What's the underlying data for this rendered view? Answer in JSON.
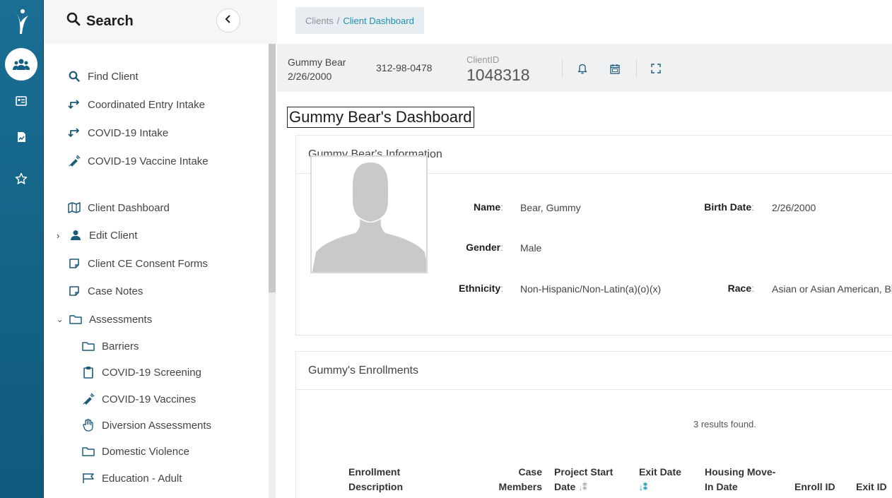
{
  "sidebar": {
    "title": "Search",
    "items": [
      {
        "label": "Find Client"
      },
      {
        "label": "Coordinated Entry Intake"
      },
      {
        "label": "COVID-19 Intake"
      },
      {
        "label": "COVID-19 Vaccine Intake"
      },
      {
        "label": "Client Dashboard"
      },
      {
        "label": "Edit Client"
      },
      {
        "label": "Client CE Consent Forms"
      },
      {
        "label": "Case Notes"
      },
      {
        "label": "Assessments"
      }
    ],
    "assessments": [
      {
        "label": "Barriers"
      },
      {
        "label": "COVID-19 Screening"
      },
      {
        "label": "COVID-19 Vaccines"
      },
      {
        "label": "Diversion Assessments"
      },
      {
        "label": "Domestic Violence"
      },
      {
        "label": "Education - Adult"
      }
    ]
  },
  "breadcrumb": {
    "root": "Clients",
    "separator": "/",
    "current": "Client Dashboard"
  },
  "client_bar": {
    "name": "Gummy Bear",
    "dob": "2/26/2000",
    "ssn": "312-98-0478",
    "client_id_label": "ClientID",
    "client_id": "1048318"
  },
  "dashboard_title": "Gummy Bear's Dashboard",
  "info_card": {
    "title": "Gummy Bear's Information",
    "name_label": "Name",
    "name_value": "Bear, Gummy",
    "birth_label": "Birth Date",
    "birth_value": "2/26/2000",
    "gender_label": "Gender",
    "gender_value": "Male",
    "ethnicity_label": "Ethnicity",
    "ethnicity_value": "Non-Hispanic/Non-Latin(a)(o)(x)",
    "race_label": "Race",
    "race_value": "Asian or Asian American, Black"
  },
  "enrollments": {
    "title": "Gummy's Enrollments",
    "results": "3 results found.",
    "columns": [
      {
        "l1": "Enrollment",
        "l2": "Description"
      },
      {
        "l1": "Case",
        "l2": "Members"
      },
      {
        "l1": "Project Start",
        "l2": "Date"
      },
      {
        "l1": "Exit Date",
        "l2": ""
      },
      {
        "l1": "Housing Move-",
        "l2": "In Date"
      },
      {
        "l1": "",
        "l2": "Enroll ID"
      },
      {
        "l1": "",
        "l2": "Exit ID"
      }
    ]
  },
  "colors": {
    "rail": "#135f84",
    "accent": "#1f8fae",
    "panel": "#f0f1f2"
  },
  "icons": [
    "logo-icon",
    "clients-icon",
    "id-card-icon",
    "report-icon",
    "star-icon",
    "search-icon",
    "intake-icon",
    "vaccine-icon",
    "map-icon",
    "person-icon",
    "form-icon",
    "folder-icon",
    "clipboard-icon",
    "hand-icon",
    "flag-icon",
    "bell-icon",
    "calendar-icon",
    "expand-icon"
  ]
}
